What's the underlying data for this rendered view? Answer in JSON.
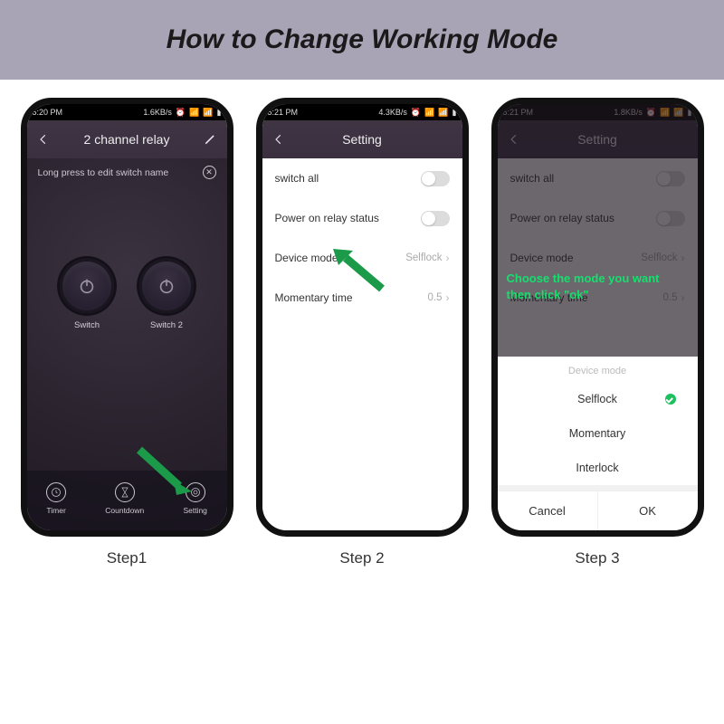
{
  "title": "How to Change Working Mode",
  "steps": {
    "step1": "Step1",
    "step2": "Step 2",
    "step3": "Step 3"
  },
  "status": {
    "time1": "5:20 PM",
    "time2": "5:21 PM",
    "time3": "5:21 PM",
    "rate1": "1.6KB/s",
    "rate2": "4.3KB/s",
    "rate3": "1.8KB/s"
  },
  "phone1": {
    "header_title": "2 channel relay",
    "tip": "Long press to edit switch name",
    "switch1": "Switch",
    "switch2": "Switch 2",
    "tab_timer": "Timer",
    "tab_countdown": "Countdown",
    "tab_setting": "Setting"
  },
  "phone2": {
    "header_title": "Setting",
    "row_switch_all": "switch all",
    "row_power_on": "Power on relay status",
    "row_device_mode": "Device mode",
    "row_device_mode_value": "Selflock",
    "row_momentary": "Momentary time",
    "row_momentary_value": "0.5"
  },
  "phone3": {
    "header_title": "Setting",
    "row_switch_all": "switch all",
    "row_power_on": "Power on relay status",
    "row_device_mode": "Device mode",
    "row_device_mode_value": "Selflock",
    "row_momentary": "Momentary time",
    "row_momentary_value": "0.5",
    "overlay_line1": "Choose the mode you want",
    "overlay_line2": "then click \"ok\"",
    "sheet_title": "Device mode",
    "option_selflock": "Selflock",
    "option_momentary": "Momentary",
    "option_interlock": "Interlock",
    "cancel": "Cancel",
    "ok": "OK"
  }
}
